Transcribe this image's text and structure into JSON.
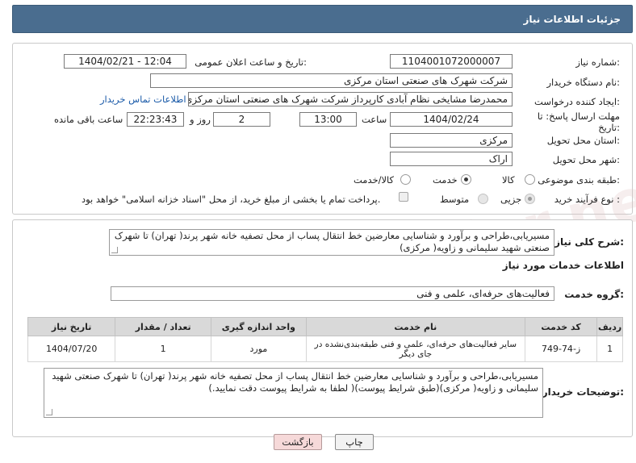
{
  "header": {
    "title": "جزئیات اطلاعات نیاز"
  },
  "form": {
    "need_number_label": "شماره نیاز:",
    "need_number": "1104001072000007",
    "announce_label": "تاریخ و ساعت اعلان عمومی:",
    "announce_value": "1404/02/21 - 12:04",
    "buyer_label": "نام دستگاه خریدار:",
    "buyer_value": "شرکت شهرک های صنعتی استان مرکزی",
    "creator_label": "ایجاد کننده درخواست:",
    "creator_value": "محمدرضا مشایخی نظام آبادی کارپرداز شرکت شهرک های صنعتی استان مرکزی",
    "contact_link": "اطلاعات تماس خریدار",
    "deadline_label_1": "مهلت ارسال پاسخ: تا",
    "deadline_label_2": "تاریخ:",
    "deadline_date": "1404/02/24",
    "time_label": "ساعت",
    "deadline_time": "13:00",
    "days_count": "2",
    "days_label": "روز و",
    "remaining_time": "22:23:43",
    "remaining_label": "ساعت باقی مانده",
    "province_label": "استان محل تحویل:",
    "province_value": "مرکزی",
    "city_label": "شهر محل تحویل:",
    "city_value": "اراک",
    "category_label": "طبقه بندی موضوعی:",
    "category_options": [
      "کالا",
      "خدمت",
      "کالا/خدمت"
    ],
    "category_selected": "خدمت",
    "process_label": "نوع فرآیند خرید :",
    "process_options": [
      "جزیی",
      "متوسط"
    ],
    "process_selected": "جزیی",
    "payment_note": "پرداخت تمام یا بخشی از مبلغ خرید، از محل \"اسناد خزانه اسلامی\" خواهد بود."
  },
  "description": {
    "label": "شرح کلی نیاز:",
    "text": "مسیریابی،طراحی و برآورد و شناسایی معارضین خط انتقال پساب از محل تصفیه خانه شهر پرند( تهران) تا شهرک صنعتی شهید سلیمانی و زاویه( مرکزی)"
  },
  "services": {
    "section_title": "اطلاعات خدمات مورد نیاز",
    "group_label": "گروه خدمت:",
    "group_value": "فعالیت‌های حرفه‌ای، علمی و فنی",
    "columns": [
      "ردیف",
      "کد خدمت",
      "نام خدمت",
      "واحد اندازه گیری",
      "تعداد / مقدار",
      "تاریخ نیاز"
    ],
    "rows": [
      [
        "1",
        "ز-74-749",
        "سایر فعالیت‌های حرفه‌ای، علمی و فنی طبقه‌بندی‌نشده در جای دیگر",
        "مورد",
        "1",
        "1404/07/20"
      ]
    ]
  },
  "buyer_notes": {
    "label": "توضیحات خریدار:",
    "text": "مسیریابی،طراحی و برآورد و شناسایی معارضین خط انتقال پساب از محل تصفیه خانه شهر پرند( تهران) تا شهرک صنعتی شهید سلیمانی و زاویه( مرکزی)(طبق شرایط پیوست)( لطفا به شرایط پیوست دقت نمایید.)"
  },
  "buttons": {
    "print": "چاپ",
    "back": "بازگشت"
  },
  "watermark": "AriaTender.neT"
}
